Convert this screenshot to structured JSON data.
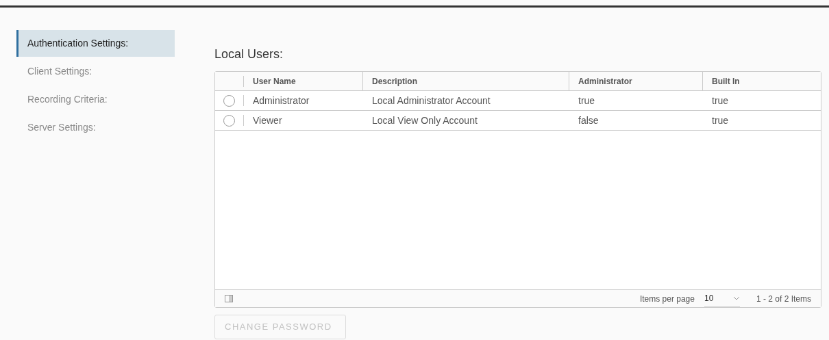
{
  "sidebar": {
    "items": [
      {
        "label": "Authentication Settings:",
        "selected": true
      },
      {
        "label": "Client Settings:",
        "selected": false
      },
      {
        "label": "Recording Criteria:",
        "selected": false
      },
      {
        "label": "Server Settings:",
        "selected": false
      }
    ]
  },
  "section_title": "Local Users:",
  "table": {
    "columns": [
      "User Name",
      "Description",
      "Administrator",
      "Built In"
    ],
    "rows": [
      {
        "selected": false,
        "cells": [
          "Administrator",
          "Local Administrator Account",
          "true",
          "true"
        ]
      },
      {
        "selected": false,
        "cells": [
          "Viewer",
          "Local View Only Account",
          "false",
          "true"
        ]
      }
    ],
    "footer": {
      "items_per_page_label": "Items per page",
      "items_per_page": "10",
      "range": "1 - 2 of 2 Items"
    }
  },
  "change_password_button": {
    "label": "CHANGE PASSWORD",
    "disabled": true
  }
}
